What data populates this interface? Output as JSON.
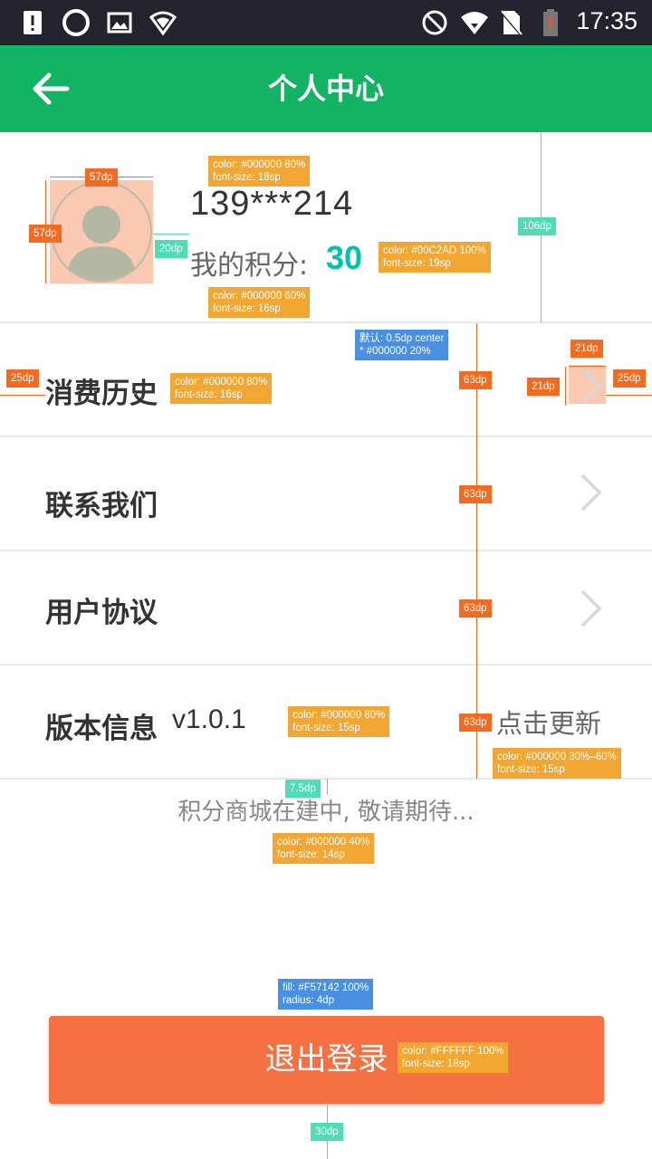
{
  "status_bar": {
    "time": "17:35",
    "left_icons": [
      "alert-icon",
      "sync-icon",
      "image-icon",
      "shield-icon"
    ],
    "right_icons": [
      "no-disturb-icon",
      "wifi-icon",
      "no-sim-icon",
      "battery-icon"
    ]
  },
  "app_bar": {
    "title": "个人中心",
    "back_icon": "arrow-left-icon",
    "background": "#12B463"
  },
  "profile": {
    "phone": "139***214",
    "points_label": "我的积分:",
    "points_value": "30",
    "avatar_icon": "person-icon"
  },
  "menu": {
    "items": [
      {
        "label": "消费历史"
      },
      {
        "label": "联系我们"
      },
      {
        "label": "用户协议"
      }
    ],
    "version": {
      "label": "版本信息",
      "value": "v1.0.1",
      "action": "点击更新"
    }
  },
  "mall_note": "积分商城在建中, 敬请期待...",
  "logout": {
    "label": "退出登录",
    "fill": "#F57142"
  },
  "annotations": {
    "phone_spec": [
      "color: #000000 80%",
      "font-size: 18sp"
    ],
    "points_spec": [
      "color: #000000 60%",
      "font-size: 16sp"
    ],
    "points_value_spec": [
      "color: #00C2AD 100%",
      "font-size: 19sp"
    ],
    "avatar_width": "57dp",
    "avatar_height": "57dp",
    "avatar_gap": "20dp",
    "header_height": "106dp",
    "divider_spec": [
      "默认: 0.5dp center",
      "* #000000 20%"
    ],
    "left_margin": "25dp",
    "item_label_spec": [
      "color: #000000 80%",
      "font-size: 16sp"
    ],
    "chevron_w": "21dp",
    "chevron_h": "21dp",
    "right_margin": "25dp",
    "row_heights": [
      "63dp",
      "63dp",
      "63dp",
      "63dp"
    ],
    "version_spec": [
      "color: #000000 80%",
      "font-size: 15sp"
    ],
    "update_spec": [
      "color: #000000 30%–60%",
      "font-size: 15sp"
    ],
    "note_gap": "7.5dp",
    "note_spec": [
      "color: #000000 40%",
      "font-size: 14sp"
    ],
    "button_spec": [
      "fill: #F57142 100%",
      "radius: 4dp"
    ],
    "button_text_spec": [
      "color: #FFFFFF 100%",
      "font-size: 18sp"
    ],
    "bottom_gap": "30dp"
  }
}
